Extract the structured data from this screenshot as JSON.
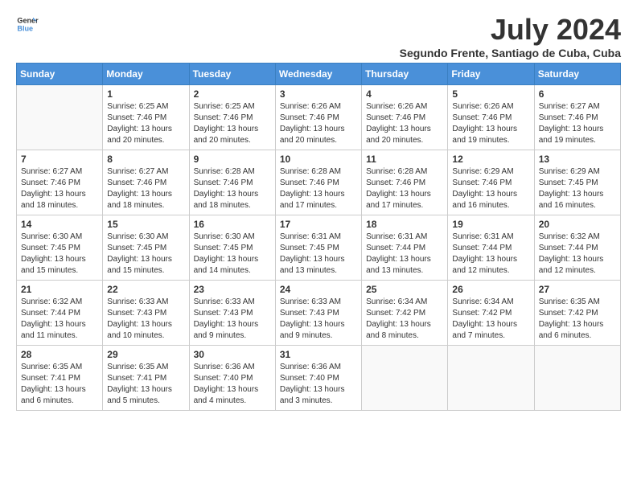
{
  "logo": {
    "line1": "General",
    "line2": "Blue"
  },
  "title": "July 2024",
  "subtitle": "Segundo Frente, Santiago de Cuba, Cuba",
  "weekdays": [
    "Sunday",
    "Monday",
    "Tuesday",
    "Wednesday",
    "Thursday",
    "Friday",
    "Saturday"
  ],
  "weeks": [
    [
      {
        "day": "",
        "sunrise": "",
        "sunset": "",
        "daylight": ""
      },
      {
        "day": "1",
        "sunrise": "6:25 AM",
        "sunset": "7:46 PM",
        "daylight": "13 hours and 20 minutes."
      },
      {
        "day": "2",
        "sunrise": "6:25 AM",
        "sunset": "7:46 PM",
        "daylight": "13 hours and 20 minutes."
      },
      {
        "day": "3",
        "sunrise": "6:26 AM",
        "sunset": "7:46 PM",
        "daylight": "13 hours and 20 minutes."
      },
      {
        "day": "4",
        "sunrise": "6:26 AM",
        "sunset": "7:46 PM",
        "daylight": "13 hours and 20 minutes."
      },
      {
        "day": "5",
        "sunrise": "6:26 AM",
        "sunset": "7:46 PM",
        "daylight": "13 hours and 19 minutes."
      },
      {
        "day": "6",
        "sunrise": "6:27 AM",
        "sunset": "7:46 PM",
        "daylight": "13 hours and 19 minutes."
      }
    ],
    [
      {
        "day": "7",
        "sunrise": "6:27 AM",
        "sunset": "7:46 PM",
        "daylight": "13 hours and 18 minutes."
      },
      {
        "day": "8",
        "sunrise": "6:27 AM",
        "sunset": "7:46 PM",
        "daylight": "13 hours and 18 minutes."
      },
      {
        "day": "9",
        "sunrise": "6:28 AM",
        "sunset": "7:46 PM",
        "daylight": "13 hours and 18 minutes."
      },
      {
        "day": "10",
        "sunrise": "6:28 AM",
        "sunset": "7:46 PM",
        "daylight": "13 hours and 17 minutes."
      },
      {
        "day": "11",
        "sunrise": "6:28 AM",
        "sunset": "7:46 PM",
        "daylight": "13 hours and 17 minutes."
      },
      {
        "day": "12",
        "sunrise": "6:29 AM",
        "sunset": "7:46 PM",
        "daylight": "13 hours and 16 minutes."
      },
      {
        "day": "13",
        "sunrise": "6:29 AM",
        "sunset": "7:45 PM",
        "daylight": "13 hours and 16 minutes."
      }
    ],
    [
      {
        "day": "14",
        "sunrise": "6:30 AM",
        "sunset": "7:45 PM",
        "daylight": "13 hours and 15 minutes."
      },
      {
        "day": "15",
        "sunrise": "6:30 AM",
        "sunset": "7:45 PM",
        "daylight": "13 hours and 15 minutes."
      },
      {
        "day": "16",
        "sunrise": "6:30 AM",
        "sunset": "7:45 PM",
        "daylight": "13 hours and 14 minutes."
      },
      {
        "day": "17",
        "sunrise": "6:31 AM",
        "sunset": "7:45 PM",
        "daylight": "13 hours and 13 minutes."
      },
      {
        "day": "18",
        "sunrise": "6:31 AM",
        "sunset": "7:44 PM",
        "daylight": "13 hours and 13 minutes."
      },
      {
        "day": "19",
        "sunrise": "6:31 AM",
        "sunset": "7:44 PM",
        "daylight": "13 hours and 12 minutes."
      },
      {
        "day": "20",
        "sunrise": "6:32 AM",
        "sunset": "7:44 PM",
        "daylight": "13 hours and 12 minutes."
      }
    ],
    [
      {
        "day": "21",
        "sunrise": "6:32 AM",
        "sunset": "7:44 PM",
        "daylight": "13 hours and 11 minutes."
      },
      {
        "day": "22",
        "sunrise": "6:33 AM",
        "sunset": "7:43 PM",
        "daylight": "13 hours and 10 minutes."
      },
      {
        "day": "23",
        "sunrise": "6:33 AM",
        "sunset": "7:43 PM",
        "daylight": "13 hours and 9 minutes."
      },
      {
        "day": "24",
        "sunrise": "6:33 AM",
        "sunset": "7:43 PM",
        "daylight": "13 hours and 9 minutes."
      },
      {
        "day": "25",
        "sunrise": "6:34 AM",
        "sunset": "7:42 PM",
        "daylight": "13 hours and 8 minutes."
      },
      {
        "day": "26",
        "sunrise": "6:34 AM",
        "sunset": "7:42 PM",
        "daylight": "13 hours and 7 minutes."
      },
      {
        "day": "27",
        "sunrise": "6:35 AM",
        "sunset": "7:42 PM",
        "daylight": "13 hours and 6 minutes."
      }
    ],
    [
      {
        "day": "28",
        "sunrise": "6:35 AM",
        "sunset": "7:41 PM",
        "daylight": "13 hours and 6 minutes."
      },
      {
        "day": "29",
        "sunrise": "6:35 AM",
        "sunset": "7:41 PM",
        "daylight": "13 hours and 5 minutes."
      },
      {
        "day": "30",
        "sunrise": "6:36 AM",
        "sunset": "7:40 PM",
        "daylight": "13 hours and 4 minutes."
      },
      {
        "day": "31",
        "sunrise": "6:36 AM",
        "sunset": "7:40 PM",
        "daylight": "13 hours and 3 minutes."
      },
      {
        "day": "",
        "sunrise": "",
        "sunset": "",
        "daylight": ""
      },
      {
        "day": "",
        "sunrise": "",
        "sunset": "",
        "daylight": ""
      },
      {
        "day": "",
        "sunrise": "",
        "sunset": "",
        "daylight": ""
      }
    ]
  ]
}
